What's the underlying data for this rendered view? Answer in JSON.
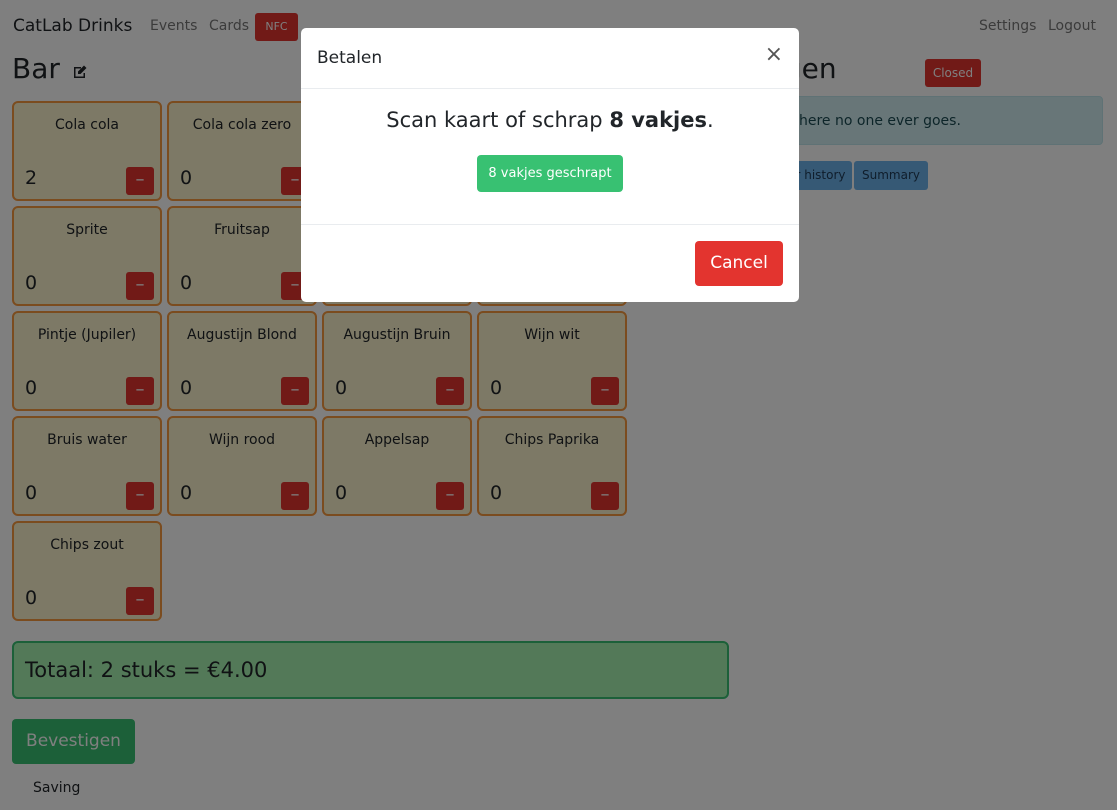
{
  "navbar": {
    "brand": "CatLab Drinks",
    "links": {
      "events": "Events",
      "cards": "Cards",
      "nfc": "NFC",
      "settings": "Settings",
      "logout": "Logout"
    }
  },
  "left": {
    "title": "Bar",
    "products": [
      {
        "name": "Cola cola",
        "qty": "2"
      },
      {
        "name": "Cola cola zero",
        "qty": "0"
      },
      {
        "name": "Sprite",
        "qty": "0"
      },
      {
        "name": "Fruitsap",
        "qty": "0"
      },
      {
        "name": "Pintje (Jupiler)",
        "qty": "0"
      },
      {
        "name": "Augustijn Blond",
        "qty": "0"
      },
      {
        "name": "Augustijn Bruin",
        "qty": "0"
      },
      {
        "name": "Wijn wit",
        "qty": "0"
      },
      {
        "name": "Bruis water",
        "qty": "0"
      },
      {
        "name": "Wijn rood",
        "qty": "0"
      },
      {
        "name": "Appelsap",
        "qty": "0"
      },
      {
        "name": "Chips Paprika",
        "qty": "0"
      },
      {
        "name": "Chips zout",
        "qty": "0"
      }
    ],
    "minus_label": "–",
    "total": "Totaal: 2 stuks = €4.00",
    "confirm": "Bevestigen",
    "saving": "Saving"
  },
  "right": {
    "title": "stellingen",
    "status": "Closed",
    "info": "here no one ever goes.",
    "buttons": {
      "history": "r history",
      "summary": "Summary"
    }
  },
  "modal": {
    "title": "Betalen",
    "close": "×",
    "text_prefix": "Scan kaart of schrap ",
    "text_strong": "8 vakjes",
    "text_suffix": ".",
    "scratched_button": "8 vakjes geschrapt",
    "cancel": "Cancel"
  },
  "colors": {
    "danger": "#e3342f",
    "success": "#38c172",
    "card_bg": "#faf2cc",
    "card_border": "#f6993f",
    "info_bg": "#d1ecf1",
    "primary_light": "#6cb2eb"
  },
  "icons": {
    "edit": "edit-icon",
    "close": "close-icon"
  }
}
